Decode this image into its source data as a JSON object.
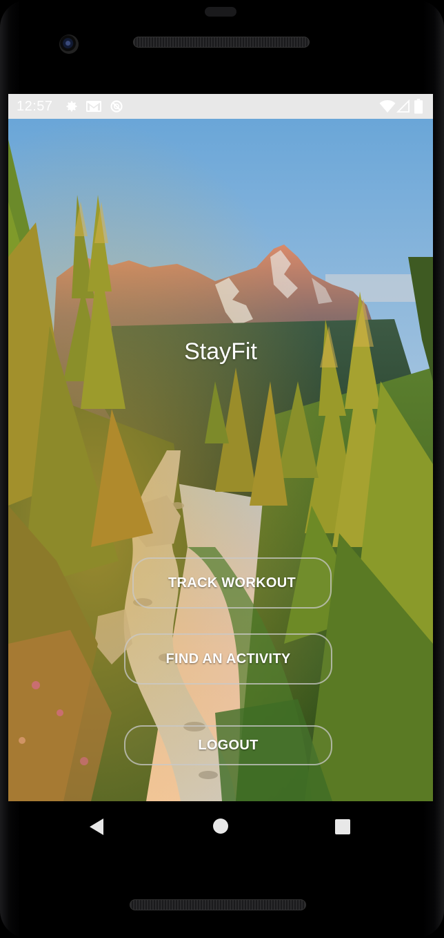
{
  "status_bar": {
    "time": "12:57",
    "left_icons": [
      "gear-icon",
      "gmail-icon",
      "sync-disabled-icon"
    ],
    "right_icons": [
      "wifi-icon",
      "cell-signal-icon",
      "battery-icon"
    ]
  },
  "app": {
    "title": "StayFit"
  },
  "buttons": {
    "track_workout": "TRACK WORKOUT",
    "find_activity": "FIND AN ACTIVITY",
    "logout": "LOGOUT"
  },
  "nav": {
    "items": [
      "back-icon",
      "home-icon",
      "recents-icon"
    ]
  },
  "colors": {
    "status_bar_bg": "#e8e8e8",
    "button_border": "#c8c8c8",
    "text": "#ffffff"
  }
}
